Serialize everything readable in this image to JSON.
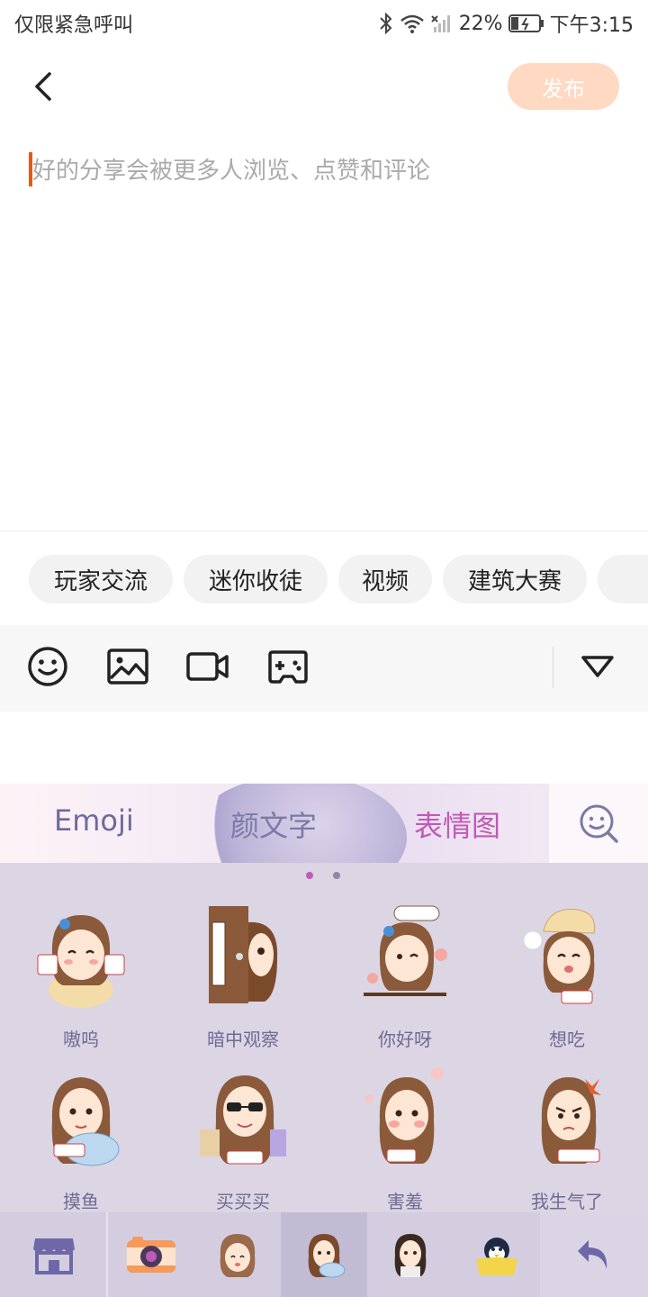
{
  "status_bar": {
    "carrier": "仅限紧急呼叫",
    "battery": "22%",
    "time": "下午3:15"
  },
  "header": {
    "publish_label": "发布"
  },
  "editor": {
    "placeholder": "好的分享会被更多人浏览、点赞和评论"
  },
  "topics": [
    "玩家交流",
    "迷你收徒",
    "视频",
    "建筑大赛"
  ],
  "keyboard": {
    "tabs": [
      "Emoji",
      "颜文字",
      "表情图"
    ],
    "active_tab": "表情图",
    "page_count": 2,
    "active_page": 1,
    "stickers": [
      "嗷呜",
      "暗中观察",
      "你好呀",
      "想吃",
      "摸鱼",
      "买买买",
      "害羞",
      "我生气了"
    ]
  },
  "colors": {
    "accent": "#e05a1a",
    "publish_disabled": "#ffd9c2",
    "sticker_label": "#6f6a93",
    "active_tab": "#c05ab5",
    "keyboard_bg": "#dbd5e4"
  }
}
